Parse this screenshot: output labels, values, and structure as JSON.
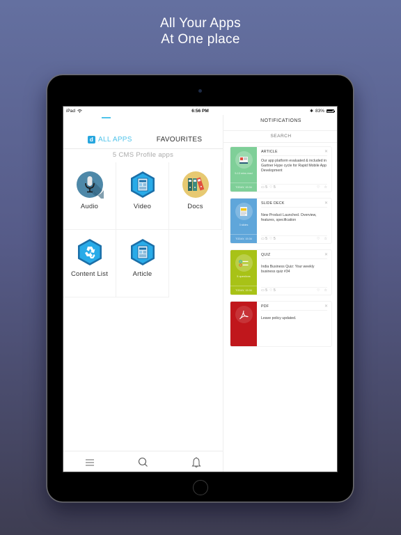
{
  "hero": {
    "line1": "All Your Apps",
    "line2": "At One place"
  },
  "statusbar": {
    "device": "iPad",
    "time": "6:56 PM",
    "battery": "83%"
  },
  "tabs": {
    "all_apps": {
      "label": "ALL APPS",
      "icon": "d",
      "active": true
    },
    "favourites": {
      "label": "FAVOURITES",
      "active": false
    }
  },
  "profile_count": "5 CMS Profile apps",
  "apps": [
    {
      "label": "Audio",
      "icon": "microphone-icon"
    },
    {
      "label": "Video",
      "icon": "hexagon-document-icon"
    },
    {
      "label": "Docs",
      "icon": "binders-icon"
    },
    {
      "label": "Content List",
      "icon": "hexagon-recycle-icon"
    },
    {
      "label": "Article",
      "icon": "hexagon-document-icon"
    }
  ],
  "bottom_nav": [
    "menu-icon",
    "search-icon",
    "bell-icon"
  ],
  "notifications": {
    "title": "NOTIFICATIONS",
    "search_placeholder": "SEARCH",
    "items": [
      {
        "type": "ARTICLE",
        "text": "Our app platform evaluated & included in Gartner Hype cycle for Rapid Mobile App Development",
        "meta": "5-13 mins read",
        "time": "TODAY, 15:34",
        "comments": "5",
        "likes": "5",
        "color": "#7fcf98"
      },
      {
        "type": "SLIDE DECK",
        "text": "New Product Launched. Overview, features, specification",
        "meta": "3 slides",
        "time": "TODAY, 15:34",
        "comments": "5",
        "likes": "5",
        "color": "#5fa6da"
      },
      {
        "type": "QUIZ",
        "text": "India Business Quiz: Your weekly business quiz #34",
        "meta": "5 questions",
        "time": "TODAY, 15:34",
        "comments": "5",
        "likes": "5",
        "color": "#a8c217"
      },
      {
        "type": "PDF",
        "text": "Leave policy updated.",
        "meta": "",
        "time": "",
        "comments": "",
        "likes": "",
        "color": "#c0171c"
      }
    ]
  },
  "colors": {
    "accent": "#4fc3ea",
    "article": "#7fcf98",
    "slide_deck": "#5fa6da",
    "quiz": "#a8c217",
    "pdf": "#c0171c"
  }
}
